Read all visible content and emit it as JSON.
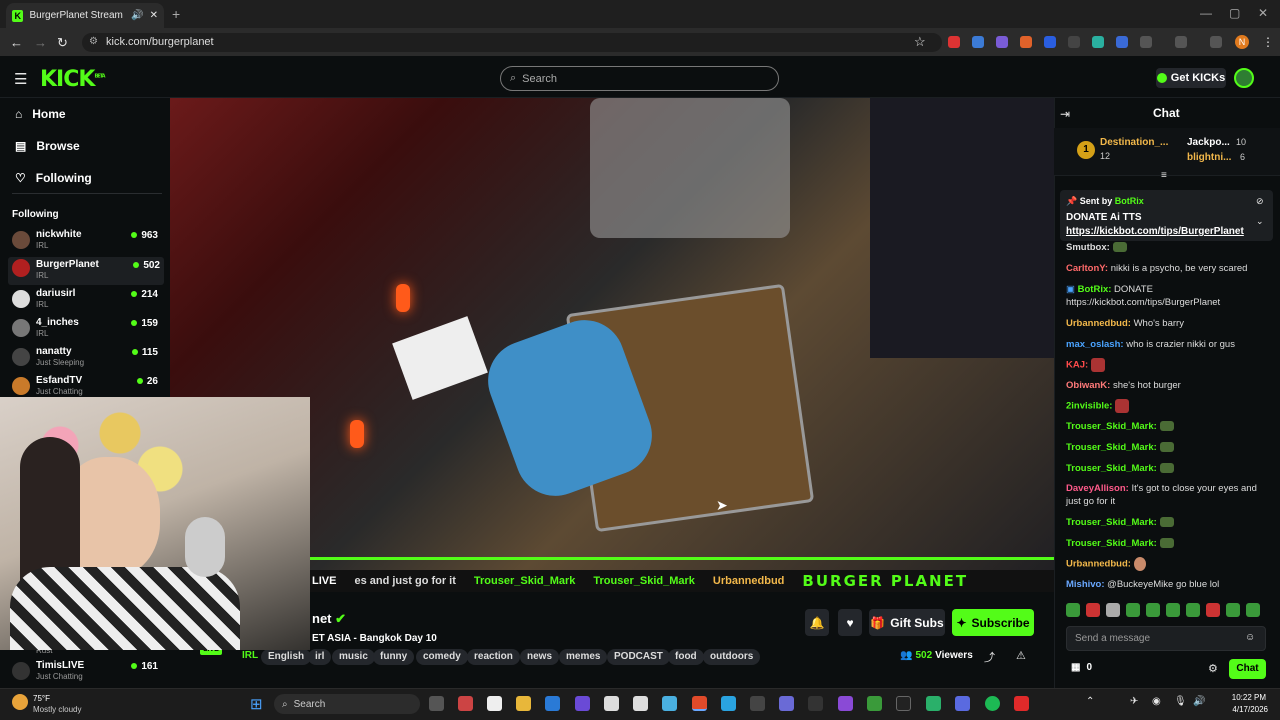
{
  "browser": {
    "tab_title": "BurgerPlanet Stream - Watch",
    "url": "kick.com/burgerplanet",
    "profile_initial": "N"
  },
  "site": {
    "logo": "KICK",
    "logo_badge": "BETA",
    "search_placeholder": "Search",
    "get_kicks": "Get KICKs"
  },
  "sidebar": {
    "nav": [
      {
        "icon": "home-icon",
        "label": "Home"
      },
      {
        "icon": "browse-icon",
        "label": "Browse"
      },
      {
        "icon": "heart-icon",
        "label": "Following"
      }
    ],
    "following_title": "Following",
    "channels": [
      {
        "name": "nickwhite",
        "category": "IRL",
        "viewers": "963"
      },
      {
        "name": "BurgerPlanet",
        "category": "IRL",
        "viewers": "502"
      },
      {
        "name": "dariusirl",
        "category": "IRL",
        "viewers": "214"
      },
      {
        "name": "4_inches",
        "category": "IRL",
        "viewers": "159"
      },
      {
        "name": "nanatty",
        "category": "Just Sleeping",
        "viewers": "115"
      },
      {
        "name": "EsfandTV",
        "category": "Just Chatting",
        "viewers": "26"
      }
    ],
    "bottom_channel": {
      "name": "TimisLIVE",
      "category": "Just Chatting",
      "viewers": "161",
      "above_category": "Rust"
    }
  },
  "video": {
    "live_label": "LIVE",
    "ticker": [
      "es and just go for it",
      "Trouser_Skid_Mark",
      "Trouser_Skid_Mark",
      "Urbannedbud"
    ],
    "overlay_text": "BURGER PLANET"
  },
  "stream": {
    "channel_fragment": "net",
    "title_fragment": "ET ASIA - Bangkok Day 10",
    "category": "IRL",
    "viewers": "502",
    "viewers_label": "Viewers",
    "tags": [
      "English",
      "irl",
      "music",
      "funny",
      "comedy",
      "reaction",
      "news",
      "memes",
      "PODCAST",
      "food",
      "outdoors"
    ],
    "gift_subs": "Gift Subs",
    "subscribe": "Subscribe"
  },
  "chat": {
    "title": "Chat",
    "leaderboard": [
      {
        "rank": "1",
        "name": "Destination_...",
        "value": "12"
      },
      {
        "name": "Jackpo...",
        "value": "10"
      },
      {
        "name": "blightni...",
        "value": "6"
      }
    ],
    "pinned": {
      "sender_label": "Sent by",
      "sender": "BotRix",
      "title": "DONATE Ai TTS",
      "link": "https://kickbot.com/tips/BurgerPlanet"
    },
    "messages": [
      {
        "user": "Smutbox:",
        "text": "",
        "color": "#e8e8e8",
        "emote": true
      },
      {
        "user": "CarltonY:",
        "text": "nikki is a psycho, be very scared",
        "color": "#ff6a6a"
      },
      {
        "user": "BotRix:",
        "text": "DONATE https://kickbot.com/tips/BurgerPlanet",
        "color": "#53fc18"
      },
      {
        "user": "Urbannedbud:",
        "text": "Who's barry",
        "color": "#f2b84b"
      },
      {
        "user": "max_oslash:",
        "text": "who is crazier nikki or gus",
        "color": "#4aa3ff"
      },
      {
        "user": "KAJ:",
        "text": "",
        "color": "#ff4b4b",
        "emote": true
      },
      {
        "user": "ObiwanK:",
        "text": "she's hot burger",
        "color": "#ff7a7a"
      },
      {
        "user": "2invisible:",
        "text": "",
        "color": "#53fc18",
        "emote": true
      },
      {
        "user": "Trouser_Skid_Mark:",
        "text": "",
        "color": "#53fc18",
        "emote": true
      },
      {
        "user": "Trouser_Skid_Mark:",
        "text": "",
        "color": "#53fc18",
        "emote": true
      },
      {
        "user": "Trouser_Skid_Mark:",
        "text": "",
        "color": "#53fc18",
        "emote": true
      },
      {
        "user": "DaveyAllison:",
        "text": "It's got to close your eyes and just go for it",
        "color": "#ff5a8a"
      },
      {
        "user": "Trouser_Skid_Mark:",
        "text": "",
        "color": "#53fc18",
        "emote": true
      },
      {
        "user": "Trouser_Skid_Mark:",
        "text": "",
        "color": "#53fc18",
        "emote": true
      },
      {
        "user": "Urbannedbud:",
        "text": "",
        "color": "#f2b84b",
        "emote": true
      },
      {
        "user": "Mishivo:",
        "text": "@BuckeyeMike go blue lol",
        "color": "#6aa8ff"
      }
    ],
    "input_placeholder": "Send a message",
    "points": "0",
    "send_label": "Chat"
  },
  "taskbar": {
    "weather_temp": "75°F",
    "weather_desc": "Mostly cloudy",
    "search": "Search",
    "time": "10:22 PM",
    "date": "4/17/2026"
  }
}
